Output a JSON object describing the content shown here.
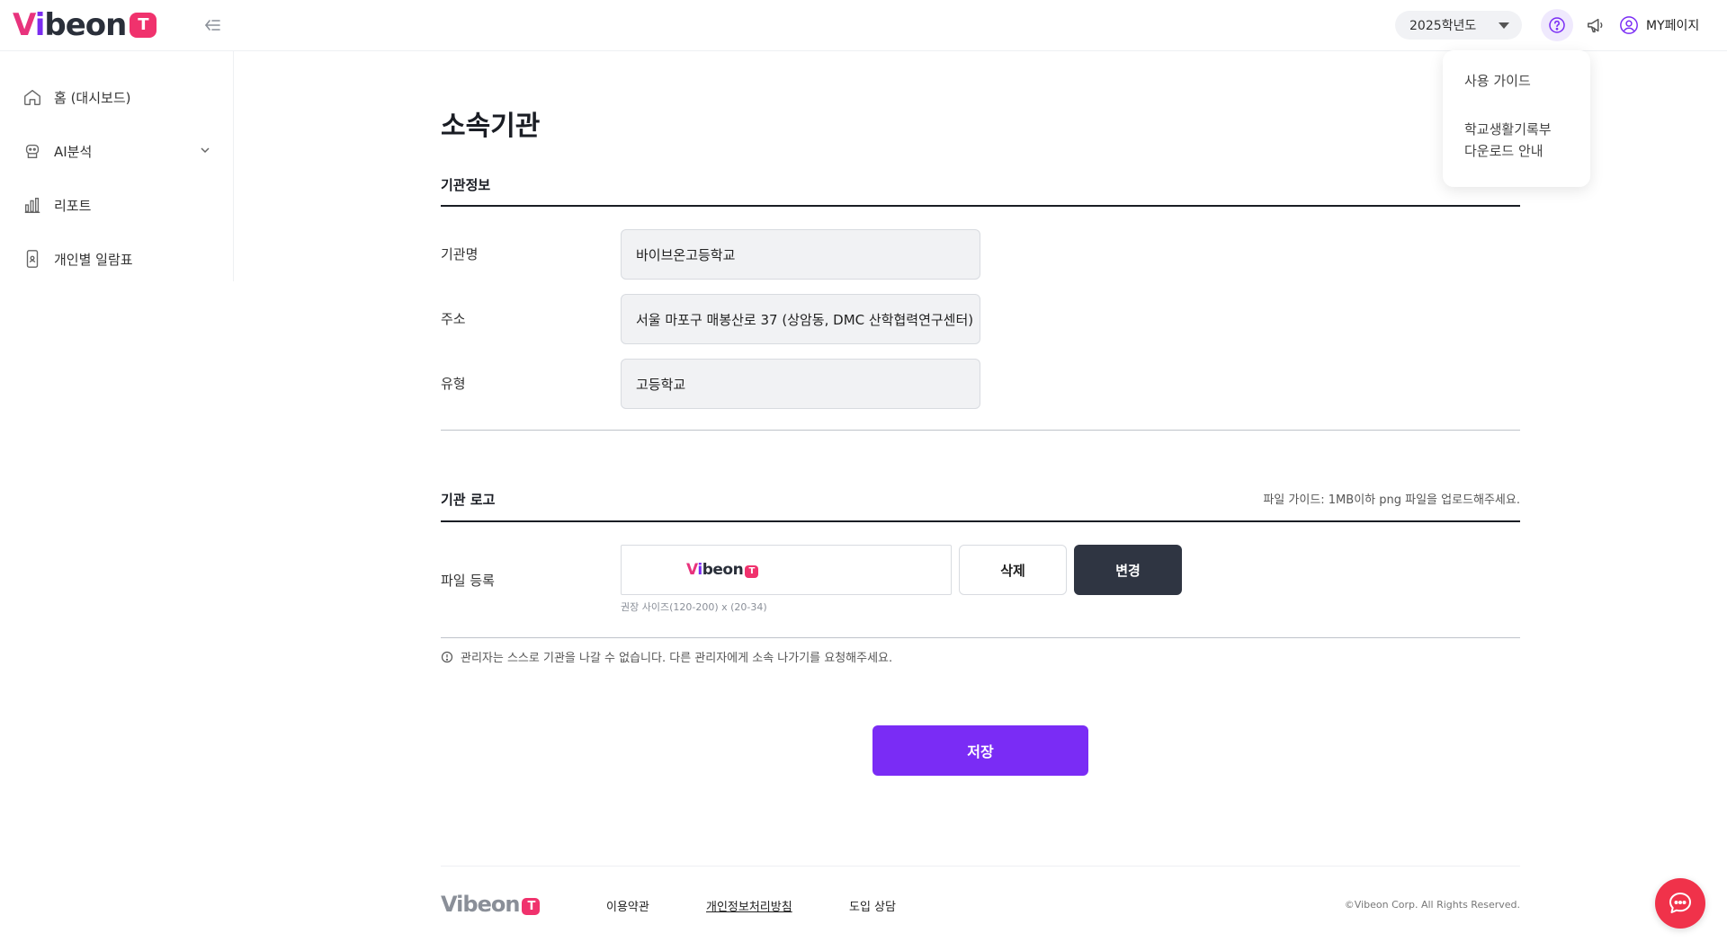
{
  "header": {
    "logo_text_v": "V",
    "logo_text_i": "i",
    "logo_text_rest": "beon",
    "logo_badge": "T",
    "year_select": "2025학년도",
    "mypage_label": "MY페이지"
  },
  "help_dropdown": {
    "items": [
      "사용 가이드",
      "학교생활기록부\n다운로드 안내"
    ]
  },
  "sidebar": {
    "items": [
      {
        "label": "홈 (대시보드)",
        "icon": "home-icon"
      },
      {
        "label": "AI분석",
        "icon": "robot-icon"
      },
      {
        "label": "리포트",
        "icon": "bar-chart-icon"
      },
      {
        "label": "개인별 일람표",
        "icon": "phone-user-icon"
      }
    ]
  },
  "main": {
    "title": "소속기관",
    "info_section": {
      "label": "기관정보",
      "fields": [
        {
          "label": "기관명",
          "value": "바이브온고등학교"
        },
        {
          "label": "주소",
          "value": "서울 마포구 매봉산로 37 (상암동, DMC 산학협력연구센터)"
        },
        {
          "label": "유형",
          "value": "고등학교"
        }
      ]
    },
    "logo_section": {
      "label": "기관 로고",
      "file_guide": "파일 가이드: 1MB이하 png 파일을 업로드해주세요.",
      "file_label": "파일 등록",
      "delete_label": "삭제",
      "change_label": "변경",
      "size_hint": "권장 사이즈(120-200) x (20-34)"
    },
    "notice": "관리자는 스스로 기관을 나갈 수 없습니다. 다른 관리자에게 소속 나가기를 요청해주세요.",
    "save_label": "저장"
  },
  "footer": {
    "links": [
      "이용약관",
      "개인정보처리방침",
      "도입 상담"
    ],
    "copyright": "©Vibeon Corp. All Rights Reserved."
  },
  "colors": {
    "accent_purple": "#7a2cf5",
    "brand_pink": "#f0326d",
    "dark_button": "#2f3542",
    "chat_red": "#f0324a"
  }
}
